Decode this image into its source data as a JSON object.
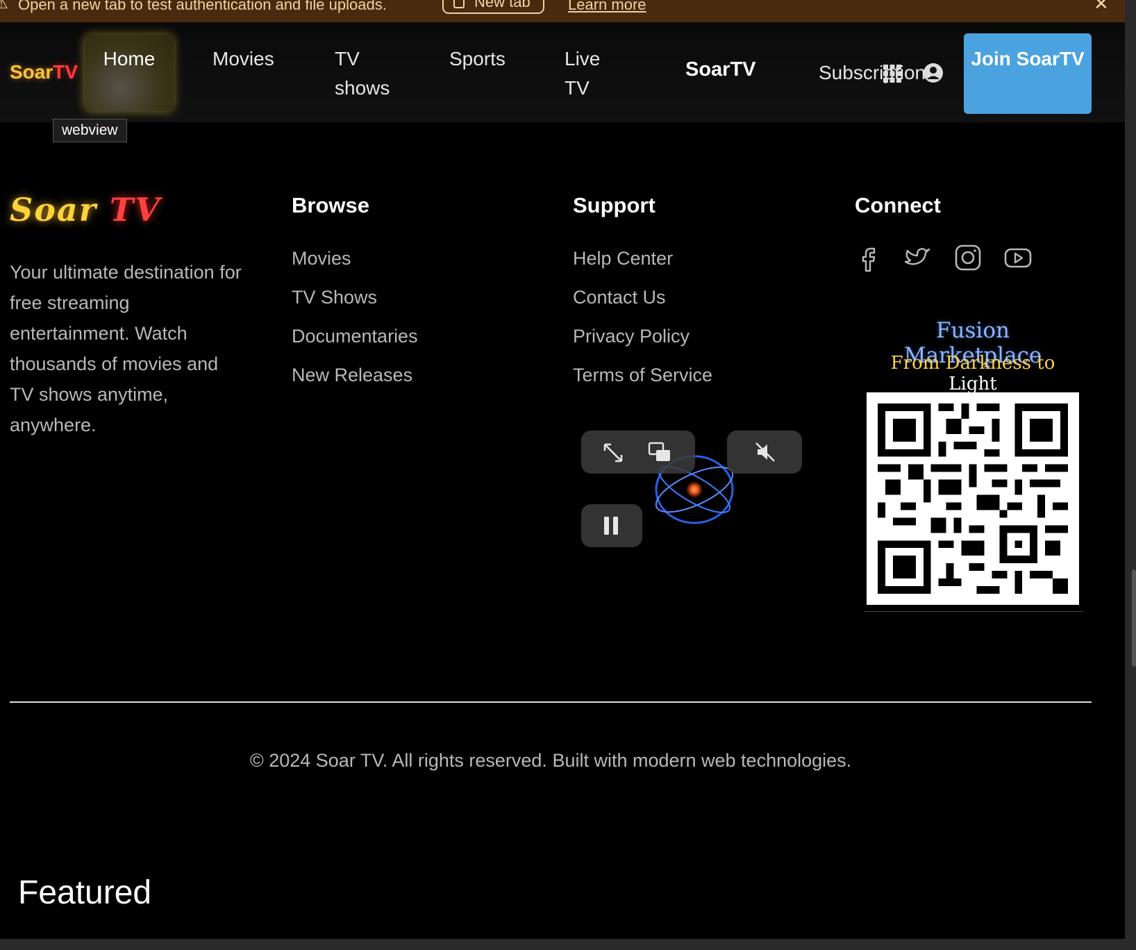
{
  "banner": {
    "message": "Open a new tab to test authentication and file uploads.",
    "new_tab_label": "New tab",
    "learn_more": "Learn more"
  },
  "nav": {
    "brand_soar": "Soar",
    "brand_tv": "TV",
    "items": [
      {
        "label": "Home"
      },
      {
        "label": "Movies"
      },
      {
        "label": "TV shows"
      },
      {
        "label": "Sports"
      },
      {
        "label": "Live TV"
      }
    ],
    "center_brand": "SoarTV",
    "subscriptions": "Subscriptions",
    "join_button": "Join SoarTV",
    "tooltip": "webview"
  },
  "footer": {
    "logo_soar": "Soar",
    "logo_tv": "TV",
    "about": "Your ultimate destination for free streaming entertainment. Watch thousands of movies and TV shows anytime, anywhere.",
    "browse": {
      "title": "Browse",
      "links": [
        "Movies",
        "TV Shows",
        "Documentaries",
        "New Releases"
      ]
    },
    "support": {
      "title": "Support",
      "links": [
        "Help Center",
        "Contact Us",
        "Privacy Policy",
        "Terms of Service"
      ]
    },
    "connect": {
      "title": "Connect",
      "icons": [
        "facebook-icon",
        "twitter-icon",
        "instagram-icon",
        "youtube-icon"
      ]
    },
    "promo": {
      "line1": "Fusion Marketplace",
      "line2_a": "From Darkness to ",
      "line2_b": "Light"
    },
    "copyright": "© 2024 Soar TV. All rights reserved. Built with modern web technologies."
  },
  "featured_heading": "Featured",
  "colors": {
    "banner_bg": "#4a2a0e",
    "accent_join": "#4aa3df",
    "brand_yellow": "#ffc23d",
    "brand_red": "#ff3b3b"
  }
}
